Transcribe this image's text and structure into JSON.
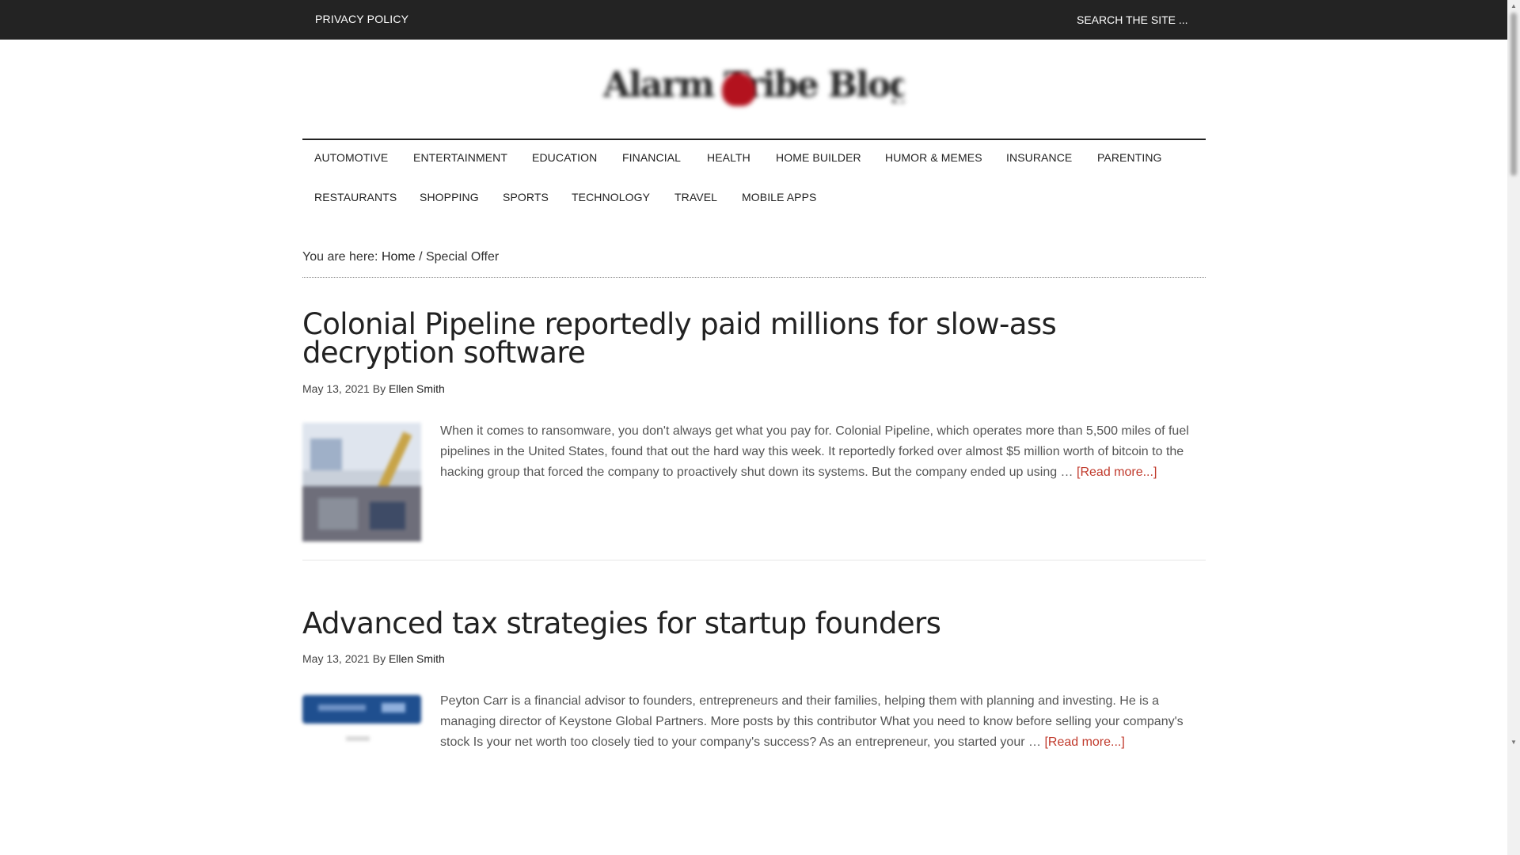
{
  "topbar": {
    "privacy_label": "PRIVACY POLICY",
    "search_placeholder": "SEARCH THE SITE ..."
  },
  "logo": {
    "text": "Alarm Tribe Blog"
  },
  "nav": {
    "items": [
      "AUTOMOTIVE",
      "ENTERTAINMENT",
      "EDUCATION",
      "FINANCIAL",
      "HEALTH",
      "HOME BUILDER",
      "HUMOR & MEMES",
      "INSURANCE",
      "PARENTING",
      "RESTAURANTS",
      "SHOPPING",
      "SPORTS",
      "TECHNOLOGY",
      "TRAVEL",
      "MOBILE APPS"
    ]
  },
  "breadcrumb": {
    "prefix": "You are here:",
    "home": "Home",
    "separator": "/",
    "current": "Special Offer"
  },
  "posts": [
    {
      "title": "Colonial Pipeline reportedly paid millions for slow-ass decryption software",
      "date": "May 13, 2021",
      "by": "By",
      "author": "Ellen Smith",
      "excerpt": "When it comes to ransomware, you don't always get what you pay for. Colonial Pipeline, which operates more than 5,500 miles of fuel pipelines in the United States, found that out the hard way this week. It reportedly forked over almost $5 million worth of bitcoin to the hacking group that forced the company to proactively shut down its systems. But the company ended up using …",
      "read_more": "[Read more...]"
    },
    {
      "title": "Advanced tax strategies for startup founders",
      "date": "May 13, 2021",
      "by": "By",
      "author": "Ellen Smith",
      "excerpt": "Peyton Carr is a financial advisor to founders, entrepreneurs and their families, helping them with planning and investing. He is a managing director of Keystone Global Partners. More posts by this contributor What you need to know before selling your company's stock Is your net worth too closely tied to your company's success? As an entrepreneur, you started your …",
      "read_more": "[Read more...]"
    }
  ],
  "colors": {
    "topbar_bg": "#232323",
    "read_more": "#c0392b",
    "logo_accent": "#b3121e"
  }
}
